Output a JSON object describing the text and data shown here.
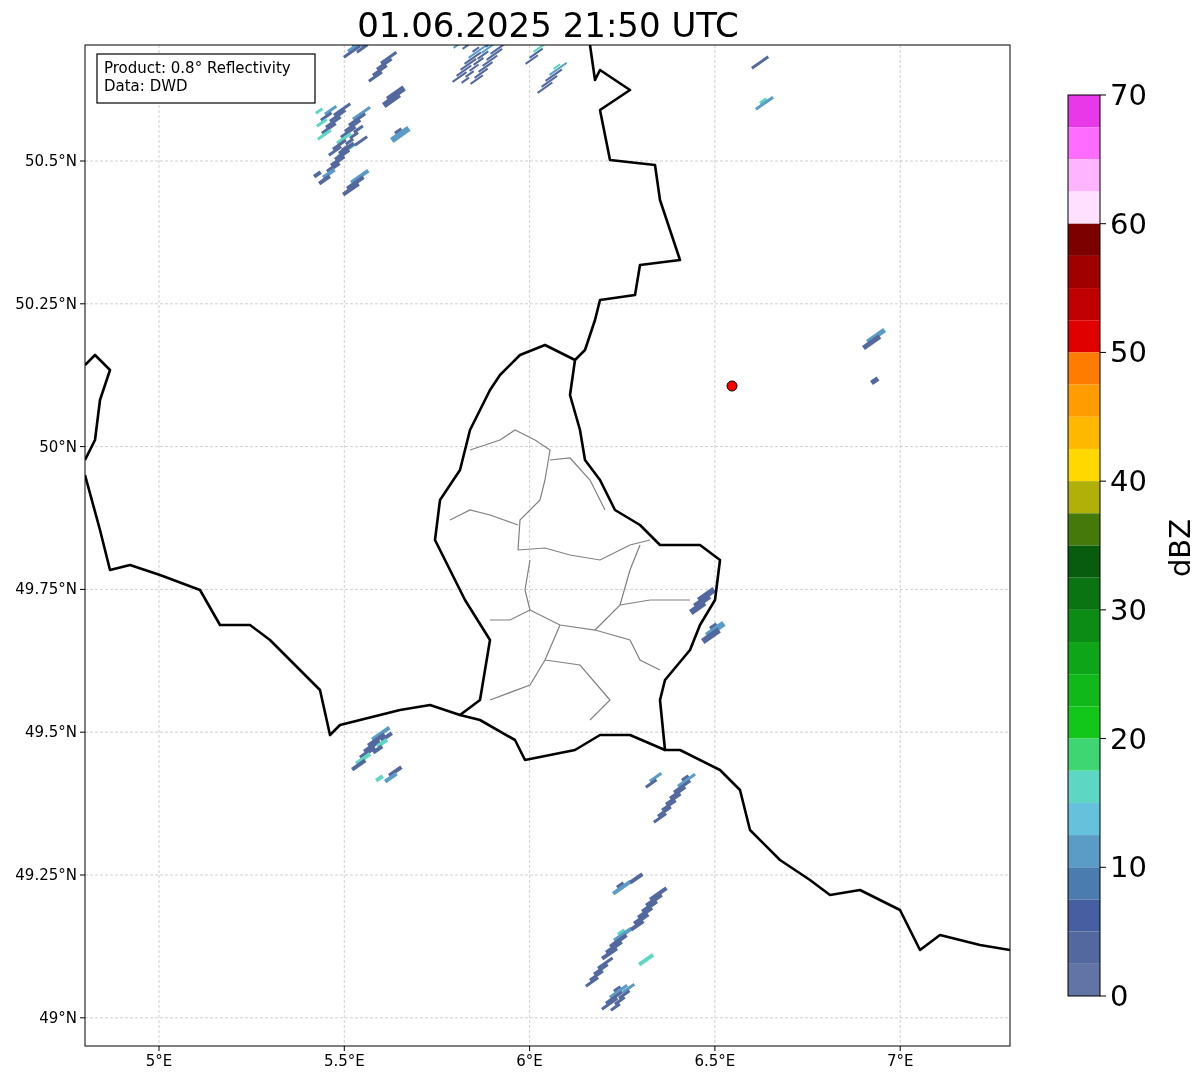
{
  "title": "01.06.2025 21:50 UTC",
  "info_box": [
    "Product: 0.8° Reflectivity",
    "Data: DWD"
  ],
  "x_ticks": [
    "5°E",
    "5.5°E",
    "6°E",
    "6.5°E",
    "7°E"
  ],
  "y_ticks": [
    "50.5°N",
    "50.25°N",
    "50°N",
    "49.75°N",
    "49.5°N",
    "49.25°N",
    "49°N"
  ],
  "colorbar": {
    "label": "dBZ",
    "ticks": [
      "70",
      "60",
      "50",
      "40",
      "30",
      "20",
      "10",
      "0"
    ],
    "segments": [
      {
        "color": "#e838e8"
      },
      {
        "color": "#ff6cff"
      },
      {
        "color": "#ffb4ff"
      },
      {
        "color": "#ffe0ff"
      },
      {
        "color": "#7c0000"
      },
      {
        "color": "#a00000"
      },
      {
        "color": "#c00000"
      },
      {
        "color": "#e00000"
      },
      {
        "color": "#ff7c00"
      },
      {
        "color": "#ff9c00"
      },
      {
        "color": "#ffb800"
      },
      {
        "color": "#ffd800"
      },
      {
        "color": "#b0b008"
      },
      {
        "color": "#457a0a"
      },
      {
        "color": "#075c0e"
      },
      {
        "color": "#0a7412"
      },
      {
        "color": "#0c8c14"
      },
      {
        "color": "#0ea618"
      },
      {
        "color": "#10b81a"
      },
      {
        "color": "#12c71a"
      },
      {
        "color": "#3ed672"
      },
      {
        "color": "#5ed6c4"
      },
      {
        "color": "#66c2dc"
      },
      {
        "color": "#5a9cc6"
      },
      {
        "color": "#4a7cb0"
      },
      {
        "color": "#455fa0"
      },
      {
        "color": "#52689e"
      },
      {
        "color": "#6273a6"
      }
    ]
  }
}
